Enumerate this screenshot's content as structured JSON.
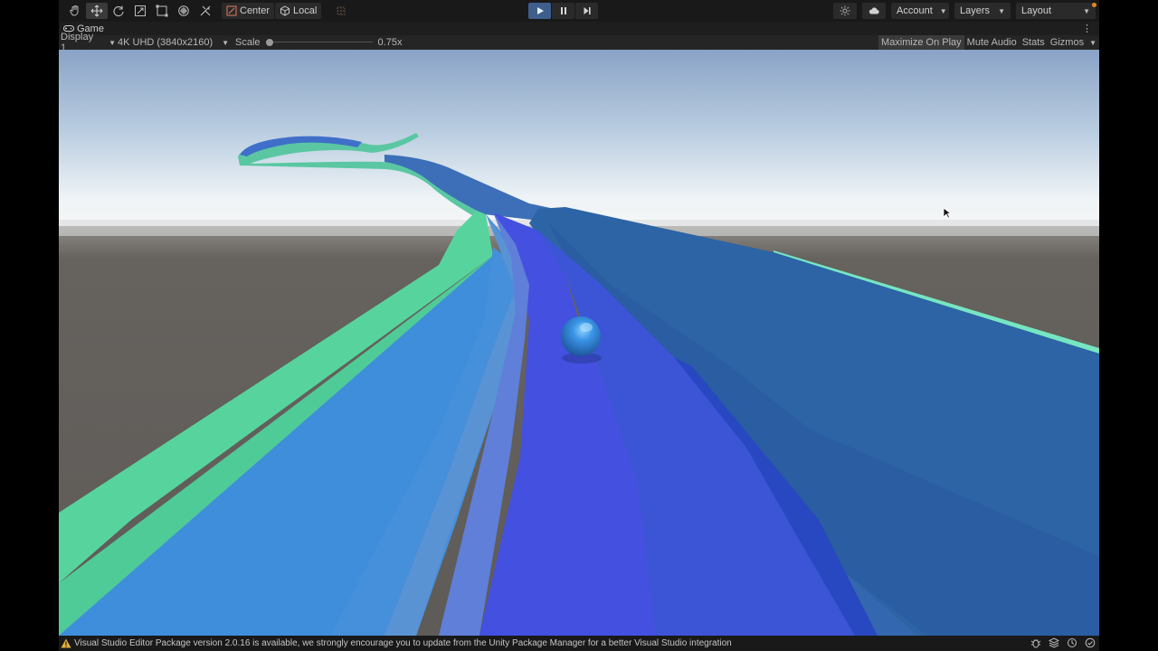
{
  "toolbar": {
    "tools": [
      "hand-tool",
      "move-tool",
      "rotate-tool",
      "scale-tool",
      "rect-tool",
      "transform-tool",
      "custom-tool"
    ],
    "pivot_mode": "Center",
    "pivot_rotation": "Local",
    "account_label": "Account",
    "layers_label": "Layers",
    "layout_label": "Layout"
  },
  "game_tab": {
    "label": "Game"
  },
  "game_controls": {
    "display": "Display 1",
    "resolution": "4K UHD (3840x2160)",
    "scale_label": "Scale",
    "scale_value": "0.75x",
    "scale_level": 0.0,
    "maximize_on_play": "Maximize On Play",
    "mute_audio": "Mute Audio",
    "stats": "Stats",
    "gizmos": "Gizmos"
  },
  "status_bar": {
    "message": "Visual Studio Editor Package version 2.0.16 is available, we strongly encourage you to update from the Unity Package Manager for a better Visual Studio integration"
  },
  "colors": {
    "play_active": "#3e5f8c",
    "track_green": "#56d6a0",
    "track_blue": "#3b86d4",
    "track_deep": "#4458e4",
    "ball": "#2f7fd6",
    "ground": "#5f5c59"
  }
}
